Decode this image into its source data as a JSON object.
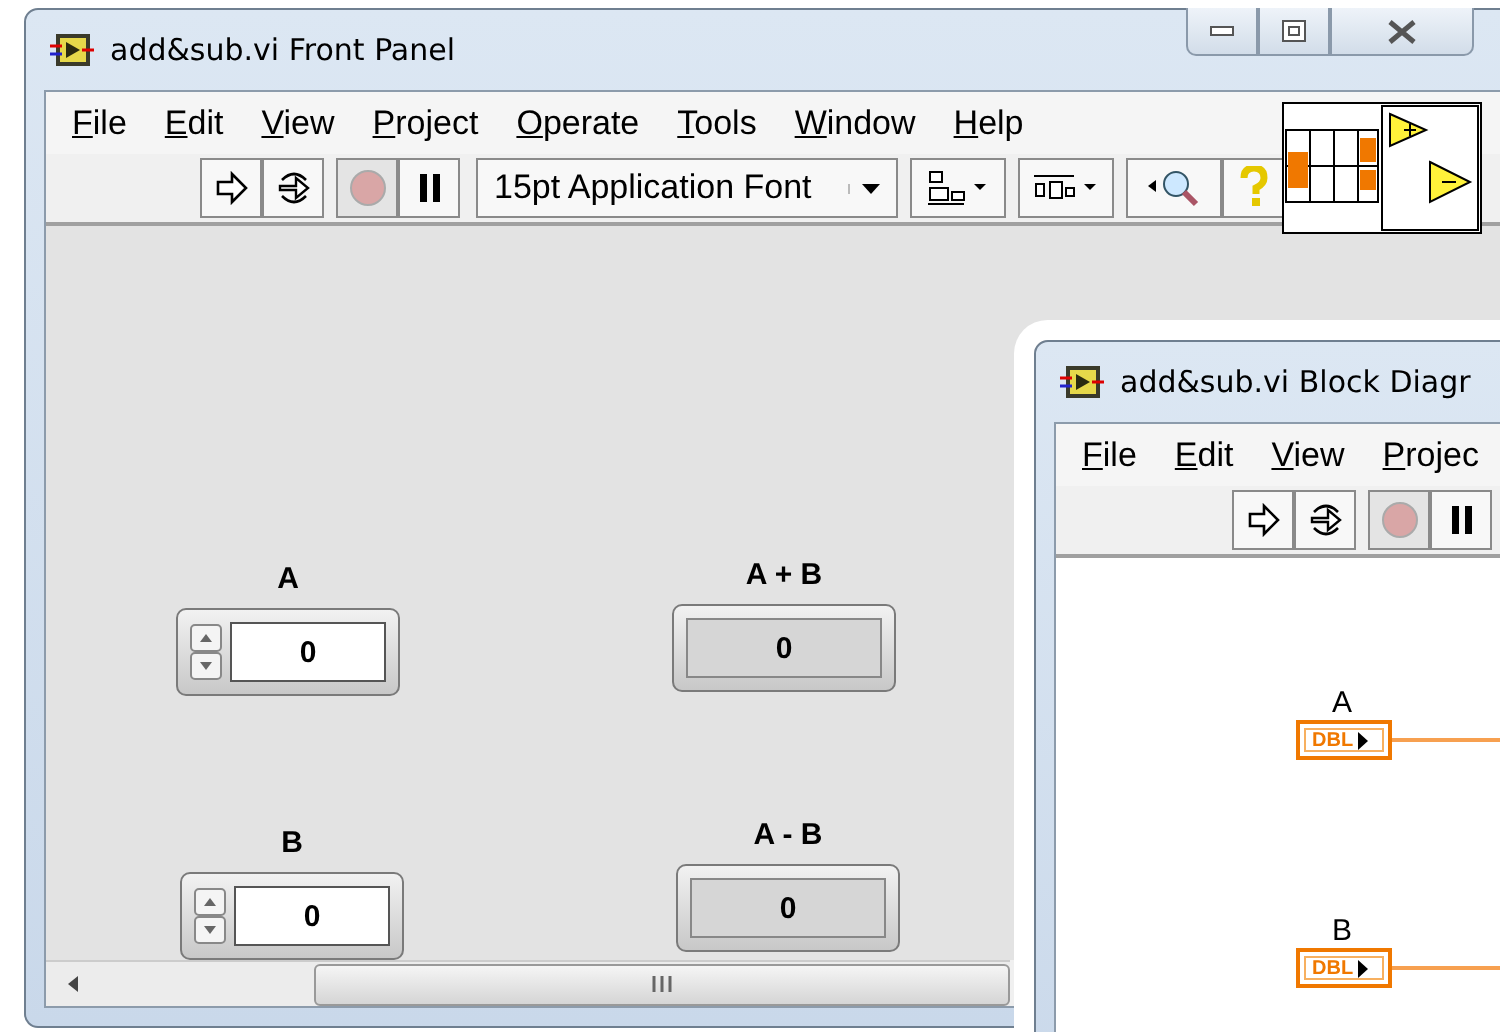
{
  "front_panel": {
    "title": "add&sub.vi Front Panel",
    "menu": [
      "File",
      "Edit",
      "View",
      "Project",
      "Operate",
      "Tools",
      "Window",
      "Help"
    ],
    "toolbar": {
      "font": "15pt Application Font"
    },
    "items": [
      {
        "kind": "control",
        "label": "A",
        "value": "0"
      },
      {
        "kind": "indicator",
        "label": "A + B",
        "value": "0"
      },
      {
        "kind": "control",
        "label": "B",
        "value": "0"
      },
      {
        "kind": "indicator",
        "label": "A - B",
        "value": "0"
      }
    ]
  },
  "block_diagram": {
    "title": "add&sub.vi Block Diagr",
    "menu": [
      "File",
      "Edit",
      "View",
      "Projec"
    ],
    "terminals": [
      {
        "label": "A",
        "type": "DBL"
      },
      {
        "label": "B",
        "type": "DBL"
      }
    ]
  }
}
